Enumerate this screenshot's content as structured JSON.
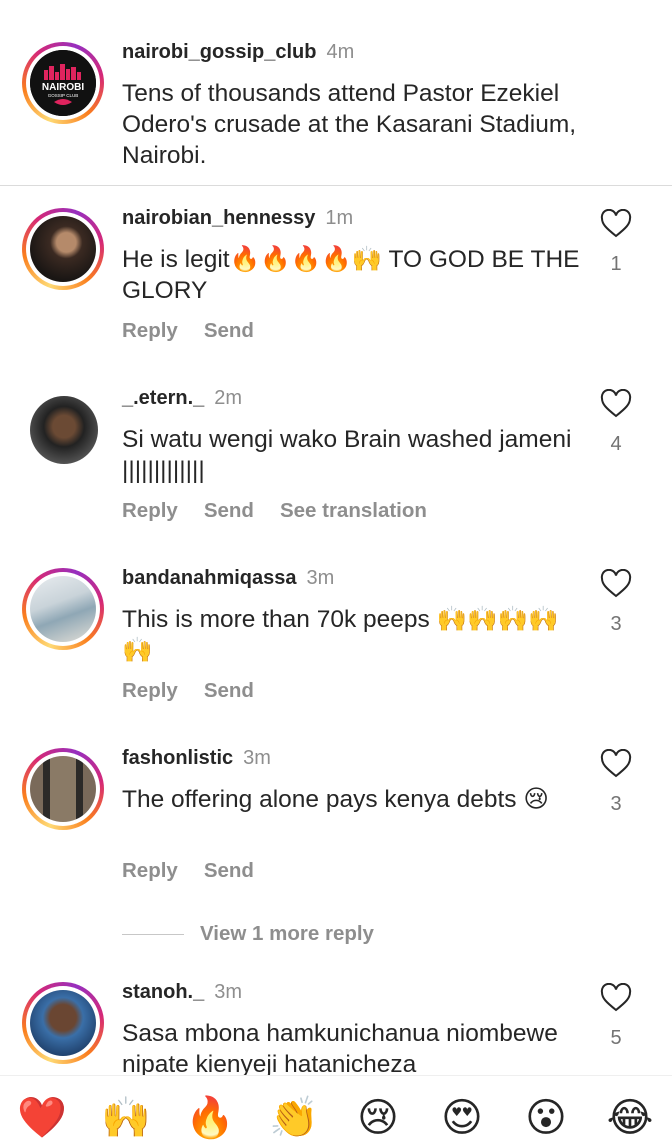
{
  "caption": {
    "username": "nairobi_gossip_club",
    "time": "4m",
    "text": "Tens of thousands attend Pastor Ezekiel Odero's crusade at the Kasarani Stadium, Nairobi.",
    "avatar_logo_line1": "NAIROBI",
    "avatar_logo_line2": "GOSSIP CLUB"
  },
  "comments": [
    {
      "username": "nairobian_hennessy",
      "time": "1m",
      "text": "He is legit🔥🔥🔥🔥🙌 TO GOD BE THE GLORY",
      "likes": "1",
      "reply": "Reply",
      "send": "Send"
    },
    {
      "username": "_.etern._",
      "time": "2m",
      "text": "Si watu wengi wako Brain washed jameni |||||||||||||",
      "likes": "4",
      "reply": "Reply",
      "send": "Send",
      "see_translation": "See translation"
    },
    {
      "username": "bandanahmiqassa",
      "time": "3m",
      "text": "This is more than 70k peeps 🙌🙌🙌🙌🙌",
      "likes": "3",
      "reply": "Reply",
      "send": "Send"
    },
    {
      "username": "fashonlistic",
      "time": "3m",
      "text": "The offering alone pays kenya debts 😢",
      "likes": "3",
      "reply": "Reply",
      "send": "Send"
    },
    {
      "username": "stanoh._",
      "time": "3m",
      "text": "Sasa mbona hamkunichanua niombewe nipate kienyeji hatanicheza",
      "likes": "5"
    }
  ],
  "view_more": "View 1 more reply",
  "emoji_bar": [
    "❤️",
    "🙌",
    "🔥",
    "👏",
    "😢",
    "😍",
    "😮",
    "😂"
  ],
  "colors": {
    "primary_text": "#262626",
    "secondary_text": "#8e8e8e",
    "heart": "#262626",
    "ring_start": "#feda75",
    "ring_end": "#d62976"
  },
  "icons": [
    "heart-outline-icon"
  ]
}
